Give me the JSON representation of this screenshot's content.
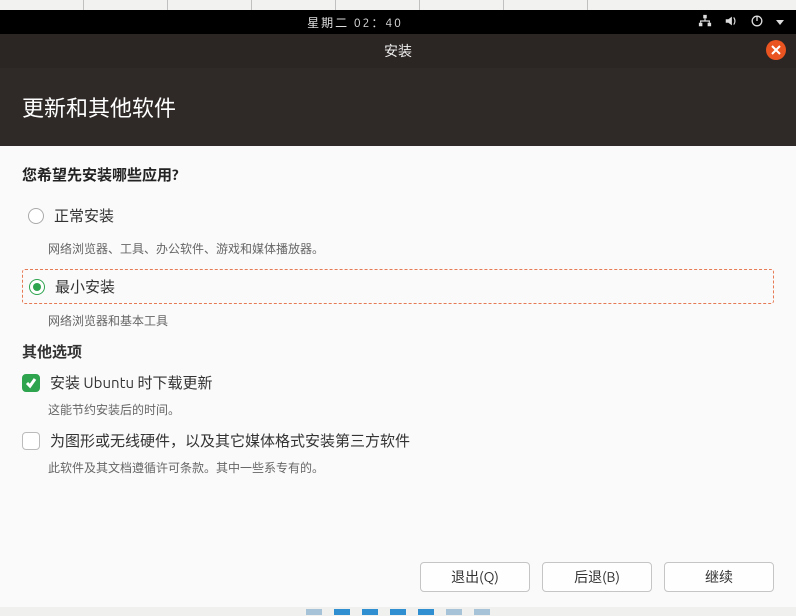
{
  "topbar": {
    "datetime": "星期二 02：40"
  },
  "window": {
    "title": "安装"
  },
  "header": {
    "title": "更新和其他软件"
  },
  "install": {
    "question": "您希望先安装哪些应用?",
    "options": [
      {
        "label": "正常安装",
        "desc": "网络浏览器、工具、办公软件、游戏和媒体播放器。",
        "selected": false
      },
      {
        "label": "最小安装",
        "desc": "网络浏览器和基本工具",
        "selected": true
      }
    ]
  },
  "other": {
    "title": "其他选项",
    "items": [
      {
        "label": "安装 Ubuntu 时下载更新",
        "desc": "这能节约安装后的时间。",
        "checked": true
      },
      {
        "label": "为图形或无线硬件，以及其它媒体格式安装第三方软件",
        "desc": "此软件及其文档遵循许可条款。其中一些系专有的。",
        "checked": false
      }
    ]
  },
  "buttons": {
    "quit": "退出(Q)",
    "back": "后退(B)",
    "continue": "继续"
  }
}
